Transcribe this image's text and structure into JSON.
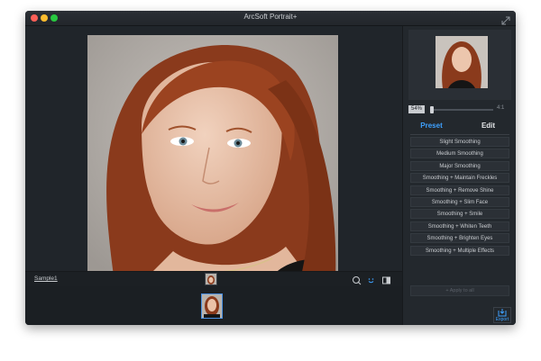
{
  "window": {
    "title": "ArcSoft Portrait+"
  },
  "preview": {
    "zoom_percent": "54%",
    "zoom_max_label": "4:1",
    "zoom_level": 0.0
  },
  "tabs": [
    {
      "label": "Preset"
    },
    {
      "label": "Edit"
    }
  ],
  "presets": [
    {
      "label": "Slight Smoothing"
    },
    {
      "label": "Medium Smoothing"
    },
    {
      "label": "Major Smoothing"
    },
    {
      "label": "Smoothing + Maintain Freckles"
    },
    {
      "label": "Smoothing + Remove Shine"
    },
    {
      "label": "Smoothing + Slim Face"
    },
    {
      "label": "Smoothing + Smile"
    },
    {
      "label": "Smoothing + Whiten Teeth"
    },
    {
      "label": "Smoothing + Brighten Eyes"
    },
    {
      "label": "Smoothing + Multiple Effects"
    }
  ],
  "apply_all_label": "Apply to all",
  "export_label": "Export",
  "bottom": {
    "sample_label": "Sample1"
  },
  "colors": {
    "accent": "#3ea1ff",
    "background": "#1f2328",
    "panel": "#23282d"
  },
  "icons": [
    "fullscreen-icon",
    "face-detect-icon",
    "smile-face-icon",
    "compare-icon",
    "plus-icon",
    "export-icon"
  ]
}
